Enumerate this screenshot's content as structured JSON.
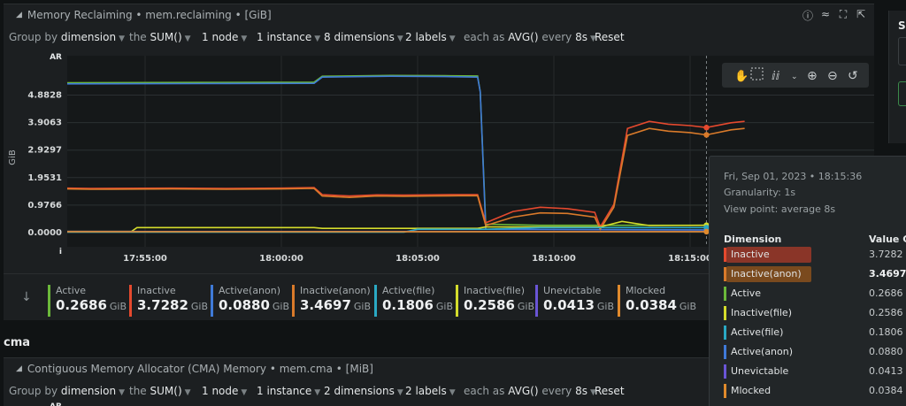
{
  "panel": {
    "title": "Memory Reclaiming • mem.reclaiming • [GiB]",
    "icons": [
      "info-icon",
      "chart-type-icon",
      "fullscreen-icon",
      "export-icon"
    ]
  },
  "groupby": {
    "group_by_label": "Group by",
    "group_by_value": "dimension",
    "the_label": "the",
    "agg_value": "SUM()",
    "nodes": "1 node",
    "instances": "1 instance",
    "dimensions": "8 dimensions",
    "labels": "2 labels",
    "each_as_label": "each as",
    "each_as_value": "AVG()",
    "every_label": "every",
    "every_value": "8s",
    "reset": "Reset"
  },
  "chart_data": {
    "type": "line",
    "ylabel": "GiB",
    "y_top_label": "AR",
    "y_ticks": [
      "4.8828",
      "3.9063",
      "2.9297",
      "1.9531",
      "0.9766",
      "0.0000"
    ],
    "y_tick_values": [
      4.8828,
      3.9063,
      2.9297,
      1.9531,
      0.9766,
      0.0
    ],
    "y_bottom_label": "i",
    "x_ticks": [
      "17:55:00",
      "18:00:00",
      "18:05:00",
      "18:10:00",
      "18:15:00"
    ],
    "x_tick_minutes": [
      55,
      60,
      65,
      70,
      75
    ],
    "xlim_minutes": [
      50.1,
      77.0
    ],
    "ylim": [
      0.0,
      5.5
    ],
    "cursor_minute": 75.6,
    "series": [
      {
        "name": "Active",
        "color": "#6bb83a",
        "points": [
          [
            50.1,
            5.32
          ],
          [
            57.0,
            5.33
          ],
          [
            61.2,
            5.34
          ],
          [
            61.5,
            5.55
          ],
          [
            64.0,
            5.58
          ],
          [
            66.0,
            5.57
          ],
          [
            67.2,
            5.56
          ],
          [
            67.3,
            5.0
          ],
          [
            67.5,
            0.3
          ],
          [
            69.5,
            0.26
          ],
          [
            77.0,
            0.26
          ]
        ]
      },
      {
        "name": "Active(anon)",
        "color": "#3f7ad8",
        "points": [
          [
            50.1,
            5.28
          ],
          [
            57.0,
            5.29
          ],
          [
            61.2,
            5.3
          ],
          [
            61.5,
            5.52
          ],
          [
            64.0,
            5.55
          ],
          [
            66.0,
            5.54
          ],
          [
            67.2,
            5.52
          ],
          [
            67.3,
            5.0
          ],
          [
            67.5,
            0.12
          ],
          [
            77.0,
            0.09
          ]
        ]
      },
      {
        "name": "Inactive",
        "color": "#e5492e",
        "points": [
          [
            50.1,
            1.58
          ],
          [
            53.0,
            1.57
          ],
          [
            56.0,
            1.58
          ],
          [
            58.0,
            1.57
          ],
          [
            60.0,
            1.58
          ],
          [
            61.2,
            1.6
          ],
          [
            61.5,
            1.35
          ],
          [
            62.5,
            1.3
          ],
          [
            63.5,
            1.34
          ],
          [
            64.5,
            1.33
          ],
          [
            65.5,
            1.34
          ],
          [
            66.5,
            1.35
          ],
          [
            67.2,
            1.35
          ],
          [
            67.5,
            0.35
          ],
          [
            68.5,
            0.75
          ],
          [
            69.5,
            0.9
          ],
          [
            70.5,
            0.85
          ],
          [
            71.5,
            0.72
          ],
          [
            71.7,
            0.2
          ],
          [
            72.2,
            1.0
          ],
          [
            72.7,
            3.7
          ],
          [
            73.5,
            3.95
          ],
          [
            74.2,
            3.85
          ],
          [
            75.0,
            3.8
          ],
          [
            75.6,
            3.73
          ],
          [
            76.5,
            3.9
          ],
          [
            77.0,
            3.95
          ]
        ]
      },
      {
        "name": "Inactive(anon)",
        "color": "#d97a2a",
        "points": [
          [
            50.1,
            1.55
          ],
          [
            53.0,
            1.54
          ],
          [
            56.0,
            1.55
          ],
          [
            58.0,
            1.54
          ],
          [
            60.0,
            1.55
          ],
          [
            61.2,
            1.57
          ],
          [
            61.5,
            1.3
          ],
          [
            62.5,
            1.25
          ],
          [
            63.5,
            1.3
          ],
          [
            64.5,
            1.29
          ],
          [
            65.5,
            1.3
          ],
          [
            66.5,
            1.31
          ],
          [
            67.2,
            1.31
          ],
          [
            67.5,
            0.25
          ],
          [
            68.5,
            0.55
          ],
          [
            69.5,
            0.7
          ],
          [
            70.5,
            0.68
          ],
          [
            71.5,
            0.55
          ],
          [
            71.7,
            0.12
          ],
          [
            72.2,
            0.9
          ],
          [
            72.7,
            3.45
          ],
          [
            73.5,
            3.7
          ],
          [
            74.2,
            3.6
          ],
          [
            75.0,
            3.55
          ],
          [
            75.6,
            3.47
          ],
          [
            76.5,
            3.65
          ],
          [
            77.0,
            3.7
          ]
        ]
      },
      {
        "name": "Inactive(file)",
        "color": "#d4dc2c",
        "points": [
          [
            50.1,
            0.04
          ],
          [
            54.5,
            0.04
          ],
          [
            54.7,
            0.18
          ],
          [
            60.0,
            0.18
          ],
          [
            61.2,
            0.18
          ],
          [
            61.5,
            0.15
          ],
          [
            67.2,
            0.15
          ],
          [
            67.5,
            0.2
          ],
          [
            71.7,
            0.2
          ],
          [
            72.5,
            0.4
          ],
          [
            73.5,
            0.25
          ],
          [
            75.6,
            0.26
          ],
          [
            77.0,
            0.26
          ]
        ]
      },
      {
        "name": "Active(file)",
        "color": "#2aa9c4",
        "points": [
          [
            50.1,
            0.02
          ],
          [
            64.5,
            0.02
          ],
          [
            65.0,
            0.12
          ],
          [
            67.5,
            0.12
          ],
          [
            69.5,
            0.18
          ],
          [
            75.6,
            0.18
          ],
          [
            77.0,
            0.18
          ]
        ]
      },
      {
        "name": "Unevictable",
        "color": "#6a55d6",
        "points": [
          [
            50.1,
            0.04
          ],
          [
            77.0,
            0.04
          ]
        ]
      },
      {
        "name": "Mlocked",
        "color": "#e08a2c",
        "points": [
          [
            50.1,
            0.035
          ],
          [
            77.0,
            0.035
          ]
        ]
      }
    ]
  },
  "legend": [
    {
      "name": "Active",
      "value": "0.2686",
      "unit": "GiB",
      "color": "#6bb83a"
    },
    {
      "name": "Inactive",
      "value": "3.7282",
      "unit": "GiB",
      "color": "#e5492e"
    },
    {
      "name": "Active(anon)",
      "value": "0.0880",
      "unit": "GiB",
      "color": "#3f7ad8"
    },
    {
      "name": "Inactive(anon)",
      "value": "3.4697",
      "unit": "GiB",
      "color": "#d97a2a"
    },
    {
      "name": "Active(file)",
      "value": "0.1806",
      "unit": "GiB",
      "color": "#2aa9c4"
    },
    {
      "name": "Inactive(file)",
      "value": "0.2586",
      "unit": "GiB",
      "color": "#d4dc2c"
    },
    {
      "name": "Unevictable",
      "value": "0.0413",
      "unit": "GiB",
      "color": "#6a55d6"
    },
    {
      "name": "Mlocked",
      "value": "0.0384",
      "unit": "GiB",
      "color": "#e08a2c"
    }
  ],
  "tooltip": {
    "datetime": "Fri, Sep 01, 2023 • 18:15:36",
    "granularity": "Granularity: 1s",
    "view_point": "View point: average 8s",
    "col_dimension": "Dimension",
    "col_value": "Value GiB",
    "rows": [
      {
        "name": "Inactive",
        "value": "3.7282",
        "color": "#e5492e",
        "highlight": "#8a3528"
      },
      {
        "name": "Inactive(anon)",
        "value": "3.4697",
        "color": "#d97a2a",
        "highlight": "#7a4a1e",
        "bold": true
      },
      {
        "name": "Active",
        "value": "0.2686",
        "color": "#6bb83a"
      },
      {
        "name": "Inactive(file)",
        "value": "0.2586",
        "color": "#d4dc2c"
      },
      {
        "name": "Active(file)",
        "value": "0.1806",
        "color": "#2aa9c4"
      },
      {
        "name": "Active(anon)",
        "value": "0.0880",
        "color": "#3f7ad8"
      },
      {
        "name": "Unevictable",
        "value": "0.0413",
        "color": "#6a55d6"
      },
      {
        "name": "Mlocked",
        "value": "0.0384",
        "color": "#e08a2c"
      }
    ]
  },
  "section": {
    "title": "cma"
  },
  "cma_panel": {
    "title": "Contiguous Memory Allocator (CMA) Memory • mem.cma • [MiB]",
    "group_by_label": "Group by",
    "group_by_value": "dimension",
    "the_label": "the",
    "agg_value": "SUM()",
    "nodes": "1 node",
    "instances": "1 instance",
    "dimensions": "2 dimensions",
    "labels": "2 labels",
    "each_as_label": "each as",
    "each_as_value": "AVG()",
    "every_label": "every",
    "every_value": "8s",
    "reset": "Reset",
    "y_top_label": "AR"
  },
  "right_panel": {
    "label": "Se"
  }
}
